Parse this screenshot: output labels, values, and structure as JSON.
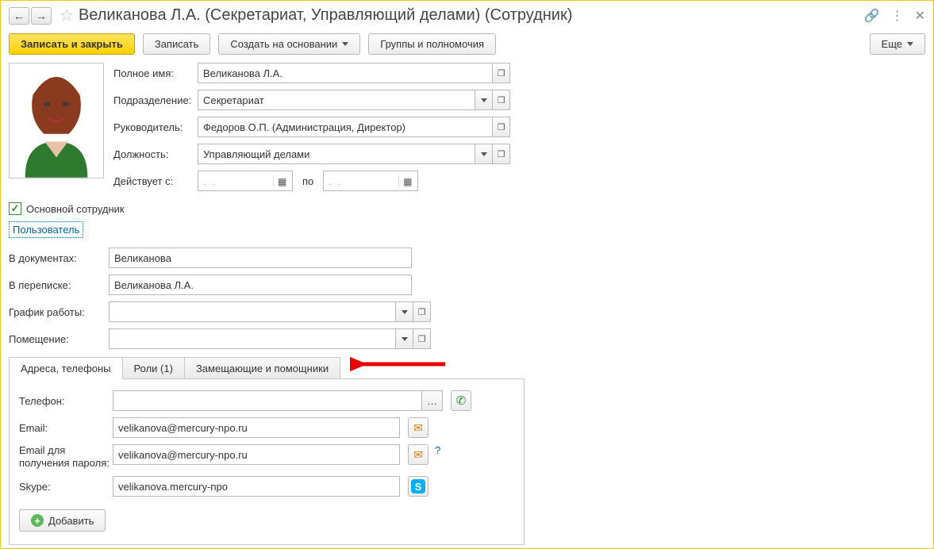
{
  "title": "Великанова Л.А. (Секретариат, Управляющий делами) (Сотрудник)",
  "toolbar": {
    "save_close": "Записать и закрыть",
    "save": "Записать",
    "create_from": "Создать на основании",
    "groups": "Группы и полномочия",
    "more": "Еще"
  },
  "labels": {
    "full_name": "Полное имя:",
    "department": "Подразделение:",
    "manager": "Руководитель:",
    "position": "Должность:",
    "valid_from": "Действует с:",
    "to": "по",
    "main_employee": "Основной сотрудник",
    "user_link": "Пользователь",
    "in_documents": "В документах:",
    "in_correspondence": "В переписке:",
    "schedule": "График работы:",
    "room": "Помещение:"
  },
  "values": {
    "full_name": "Великанова Л.А.",
    "department": "Секретариат",
    "manager": "Федоров О.П. (Администрация, Директор)",
    "position": "Управляющий делами",
    "date_from": "  .  .    ",
    "date_to": "  .  .    ",
    "main_employee_checked": true,
    "in_documents": "Великанова",
    "in_correspondence": "Великанова Л.А.",
    "schedule": "",
    "room": ""
  },
  "tabs": {
    "addresses": "Адреса, телефоны",
    "roles": "Роли (1)",
    "substitutes": "Замещающие и помощники"
  },
  "contacts": {
    "phone_label": "Телефон:",
    "email_label": "Email:",
    "email_pwd_label": "Email для получения пароля:",
    "skype_label": "Skype:",
    "add": "Добавить",
    "phone": "",
    "email": "velikanova@mercury-npo.ru",
    "email_pwd": "velikanova@mercury-npo.ru",
    "skype": "velikanova.mercury-npo",
    "help": "?"
  }
}
